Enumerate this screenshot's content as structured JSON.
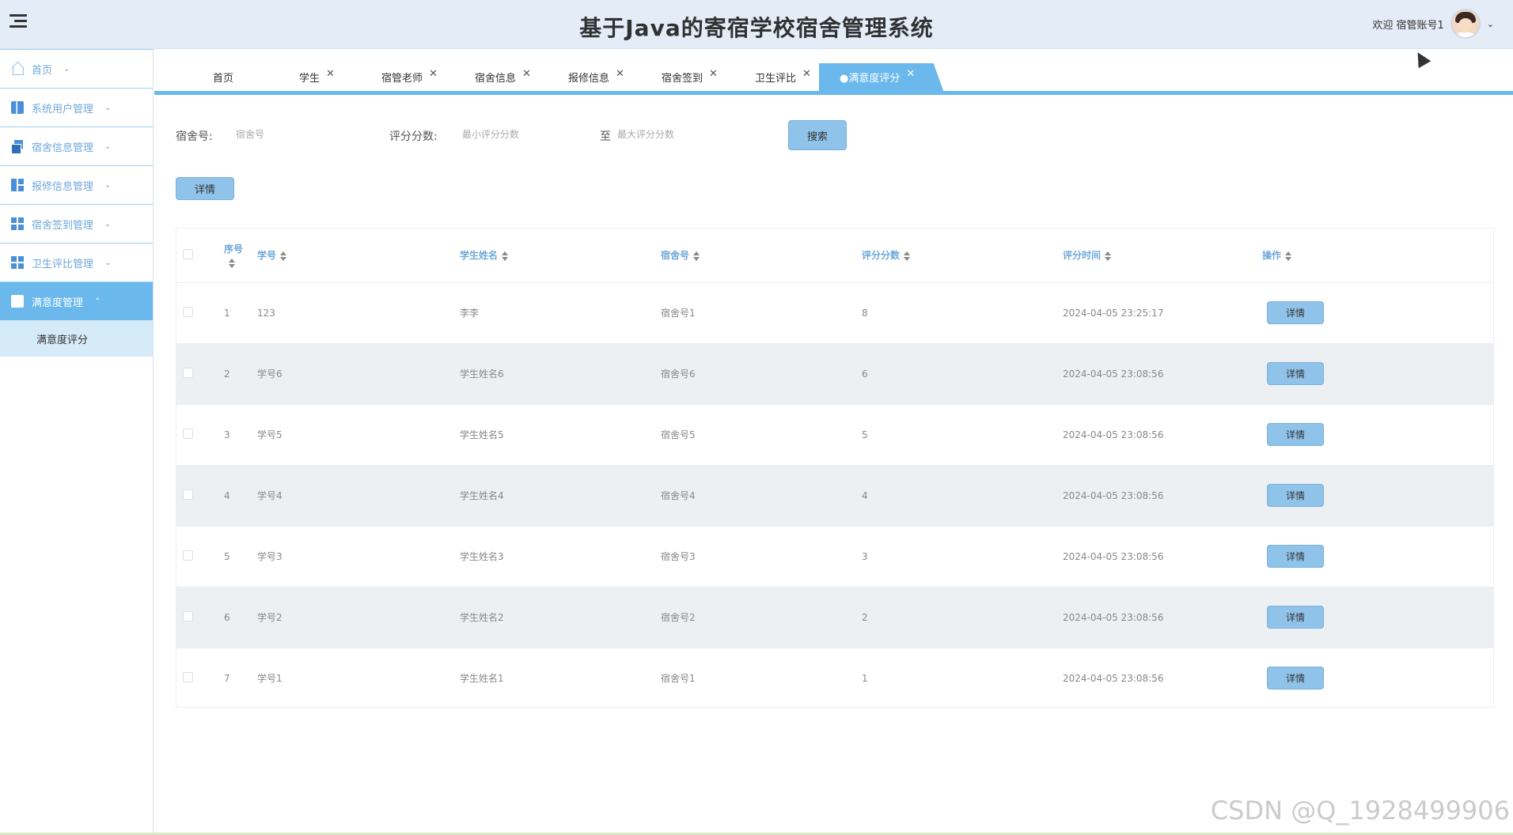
{
  "header": {
    "title": "基于Java的寄宿学校宿舍管理系统",
    "welcome": "欢迎 宿管账号1"
  },
  "sidebar": {
    "items": [
      {
        "label": "首页",
        "icon": "home-icon",
        "active": false
      },
      {
        "label": "系统用户管理",
        "icon": "book-icon",
        "active": false
      },
      {
        "label": "宿舍信息管理",
        "icon": "copy-icon",
        "active": false
      },
      {
        "label": "报修信息管理",
        "icon": "dashboard-icon",
        "active": false
      },
      {
        "label": "宿舍签到管理",
        "icon": "grid-icon",
        "active": false
      },
      {
        "label": "卫生评比管理",
        "icon": "grid-icon",
        "active": false
      },
      {
        "label": "满意度管理",
        "icon": "folder-icon",
        "active": true
      }
    ],
    "sub_items": [
      "满意度评分"
    ]
  },
  "tabs": [
    {
      "label": "首页",
      "closable": false
    },
    {
      "label": "学生",
      "closable": true
    },
    {
      "label": "宿管老师",
      "closable": true
    },
    {
      "label": "宿舍信息",
      "closable": true
    },
    {
      "label": "报修信息",
      "closable": true
    },
    {
      "label": "宿舍签到",
      "closable": true
    },
    {
      "label": "卫生评比",
      "closable": true
    },
    {
      "label": "●满意度评分",
      "closable": true,
      "active": true
    }
  ],
  "search": {
    "room_label": "宿舍号:",
    "room_placeholder": "宿舍号",
    "score_label": "评分分数:",
    "min_placeholder": "最小评分分数",
    "to_label": "至",
    "max_placeholder": "最大评分分数",
    "search_button": "搜索",
    "detail_button": "详情"
  },
  "table": {
    "headers": [
      "序号",
      "学号",
      "学生姓名",
      "宿舍号",
      "评分分数",
      "评分时间",
      "操作"
    ],
    "rows": [
      [
        "1",
        "123",
        "李李",
        "宿舍号1",
        "8",
        "2024-04-05 23:25:17",
        "详情"
      ],
      [
        "2",
        "学号6",
        "学生姓名6",
        "宿舍号6",
        "6",
        "2024-04-05 23:08:56",
        "详情"
      ],
      [
        "3",
        "学号5",
        "学生姓名5",
        "宿舍号5",
        "5",
        "2024-04-05 23:08:56",
        "详情"
      ],
      [
        "4",
        "学号4",
        "学生姓名4",
        "宿舍号4",
        "4",
        "2024-04-05 23:08:56",
        "详情"
      ],
      [
        "5",
        "学号3",
        "学生姓名3",
        "宿舍号3",
        "3",
        "2024-04-05 23:08:56",
        "详情"
      ],
      [
        "6",
        "学号2",
        "学生姓名2",
        "宿舍号2",
        "2",
        "2024-04-05 23:08:56",
        "详情"
      ],
      [
        "7",
        "学号1",
        "学生姓名1",
        "宿舍号1",
        "1",
        "2024-04-05 23:08:56",
        "详情"
      ]
    ]
  },
  "watermark": "CSDN @Q_1928499906",
  "colors": {
    "accent": "#6ab8ec",
    "header_bg": "#e4edf7",
    "button_bg": "#8fc3ea",
    "stripe_bg": "#edf0f2"
  }
}
